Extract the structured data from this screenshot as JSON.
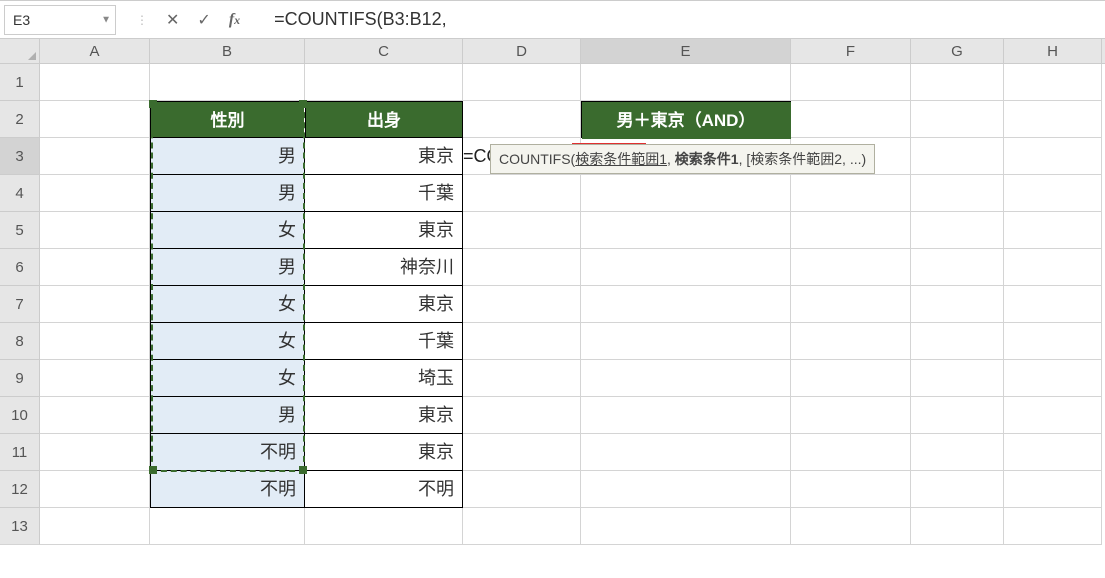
{
  "formula_bar": {
    "name_box": "E3",
    "formula_text": "=COUNTIFS(B3:B12,"
  },
  "columns": [
    "A",
    "B",
    "C",
    "D",
    "E",
    "F",
    "G",
    "H"
  ],
  "table": {
    "headers": {
      "b": "性別",
      "c": "出身"
    },
    "e_header": "男＋東京（AND）",
    "rows": [
      {
        "b": "男",
        "c": "東京"
      },
      {
        "b": "男",
        "c": "千葉"
      },
      {
        "b": "女",
        "c": "東京"
      },
      {
        "b": "男",
        "c": "神奈川"
      },
      {
        "b": "女",
        "c": "東京"
      },
      {
        "b": "女",
        "c": "千葉"
      },
      {
        "b": "女",
        "c": "埼玉"
      },
      {
        "b": "男",
        "c": "東京"
      },
      {
        "b": "不明",
        "c": "東京"
      },
      {
        "b": "不明",
        "c": "不明"
      }
    ]
  },
  "formula_cell": {
    "prefix": "=COUNTIFS",
    "paren": "(",
    "range": "B3:B12",
    "suffix": ","
  },
  "tooltip": {
    "fn": "COUNTIFS(",
    "arg1": "検索条件範囲1",
    "arg2": "検索条件1",
    "rest": ", [検索条件範囲2, ...)"
  },
  "row_count": 13
}
